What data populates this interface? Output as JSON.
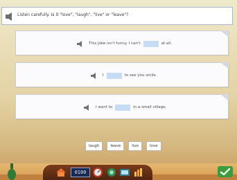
{
  "header": {
    "instruction": "Listen carefully. Is it \"love\", \"laugh\", \"live\" or \"leave\"?"
  },
  "sentences": [
    {
      "before": "This joke isn't funny. I can't",
      "after": "at all."
    },
    {
      "before": "I",
      "after": "to see you smile."
    },
    {
      "before": "I want to",
      "after": "in a small village."
    }
  ],
  "word_options": [
    "laugh",
    "leave",
    "live",
    "love"
  ],
  "toolbar": {
    "timer": "0100"
  },
  "colors": {
    "blank": "#c6dcf5",
    "toolbar": "#6a3116",
    "check": "#3c9b3c"
  }
}
